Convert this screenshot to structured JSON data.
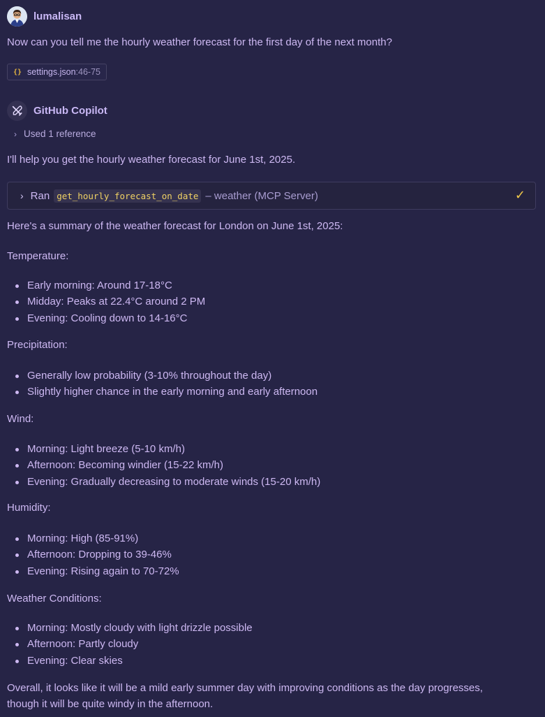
{
  "user": {
    "name": "lumalisan",
    "message": "Now can you tell me the hourly weather forecast for the first day of the next month?",
    "attachment": {
      "file": "settings.json",
      "lines": ":46-75"
    }
  },
  "assistant": {
    "name": "GitHub Copilot",
    "used_references": "Used 1 reference",
    "intro": "I'll help you get the hourly weather forecast for June 1st, 2025.",
    "tool_call": {
      "prefix": "Ran",
      "tool_name": "get_hourly_forecast_on_date",
      "server": "– weather (MCP Server)"
    },
    "summary": "Here's a summary of the weather forecast for London on June 1st, 2025:",
    "sections": [
      {
        "heading": "Temperature:",
        "items": [
          "Early morning: Around 17-18°C",
          "Midday: Peaks at 22.4°C around 2 PM",
          "Evening: Cooling down to 14-16°C"
        ]
      },
      {
        "heading": "Precipitation:",
        "items": [
          "Generally low probability (3-10% throughout the day)",
          "Slightly higher chance in the early morning and early afternoon"
        ]
      },
      {
        "heading": "Wind:",
        "items": [
          "Morning: Light breeze (5-10 km/h)",
          "Afternoon: Becoming windier (15-22 km/h)",
          "Evening: Gradually decreasing to moderate winds (15-20 km/h)"
        ]
      },
      {
        "heading": "Humidity:",
        "items": [
          "Morning: High (85-91%)",
          "Afternoon: Dropping to 39-46%",
          "Evening: Rising again to 70-72%"
        ]
      },
      {
        "heading": "Weather Conditions:",
        "items": [
          "Morning: Mostly cloudy with light drizzle possible",
          "Afternoon: Partly cloudy",
          "Evening: Clear skies"
        ]
      }
    ],
    "closing": [
      "Overall, it looks like it will be a mild early summer day with improving conditions as the day progresses,",
      "though it will be quite windy in the afternoon."
    ]
  },
  "icons": {
    "user_avatar": "avatar",
    "copilot_avatar": "tools-icon",
    "file_icon": "json-braces-icon",
    "chevron": "chevron-right-icon",
    "status": "check-icon"
  },
  "colors": {
    "background": "#262446",
    "text": "#cdb8f2",
    "code_text": "#f0d264",
    "check": "#f1c84a"
  }
}
